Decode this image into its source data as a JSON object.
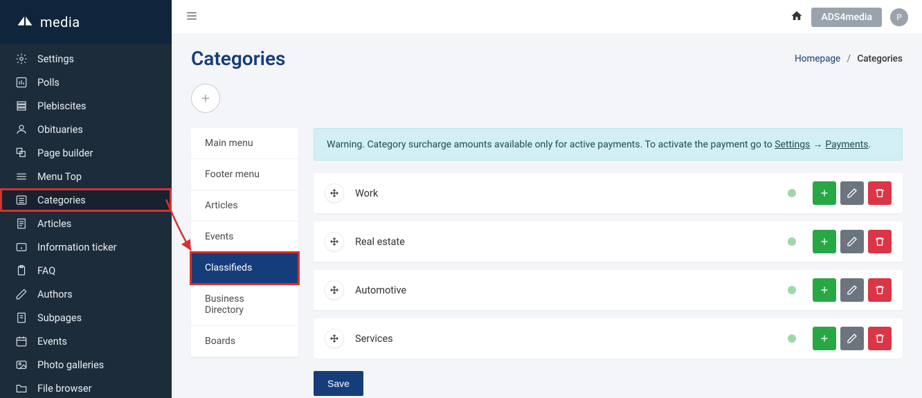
{
  "brand": {
    "name": "media"
  },
  "topbar": {
    "badge": "ADS4media",
    "avatar_initial": "P"
  },
  "page": {
    "title": "Categories"
  },
  "breadcrumb": {
    "home": "Homepage",
    "current": "Categories"
  },
  "sidebar": {
    "items": [
      {
        "label": "Settings",
        "icon": "gear"
      },
      {
        "label": "Polls",
        "icon": "chart"
      },
      {
        "label": "Plebiscites",
        "icon": "trophy"
      },
      {
        "label": "Obituaries",
        "icon": "person"
      },
      {
        "label": "Page builder",
        "icon": "layers"
      },
      {
        "label": "Menu Top",
        "icon": "menu"
      },
      {
        "label": "Categories",
        "icon": "list",
        "active": true,
        "highlighted": true
      },
      {
        "label": "Articles",
        "icon": "doc"
      },
      {
        "label": "Information ticker",
        "icon": "info"
      },
      {
        "label": "FAQ",
        "icon": "clipboard"
      },
      {
        "label": "Authors",
        "icon": "pen"
      },
      {
        "label": "Subpages",
        "icon": "page"
      },
      {
        "label": "Events",
        "icon": "calendar"
      },
      {
        "label": "Photo galleries",
        "icon": "image"
      },
      {
        "label": "File browser",
        "icon": "folder"
      }
    ]
  },
  "menu_panel": {
    "items": [
      {
        "label": "Main menu"
      },
      {
        "label": "Footer menu"
      },
      {
        "label": "Articles"
      },
      {
        "label": "Events"
      },
      {
        "label": "Classifieds",
        "selected": true,
        "highlighted": true
      },
      {
        "label": "Business Directory"
      },
      {
        "label": "Boards"
      }
    ]
  },
  "alert": {
    "prefix": "Warning. Category surcharge amounts available only for active payments. To activate the payment go to ",
    "link1": "Settings",
    "arrow": "→",
    "link2": "Payments",
    "suffix": "."
  },
  "categories": [
    {
      "name": "Work"
    },
    {
      "name": "Real estate"
    },
    {
      "name": "Automotive"
    },
    {
      "name": "Services"
    }
  ],
  "buttons": {
    "save": "Save"
  }
}
